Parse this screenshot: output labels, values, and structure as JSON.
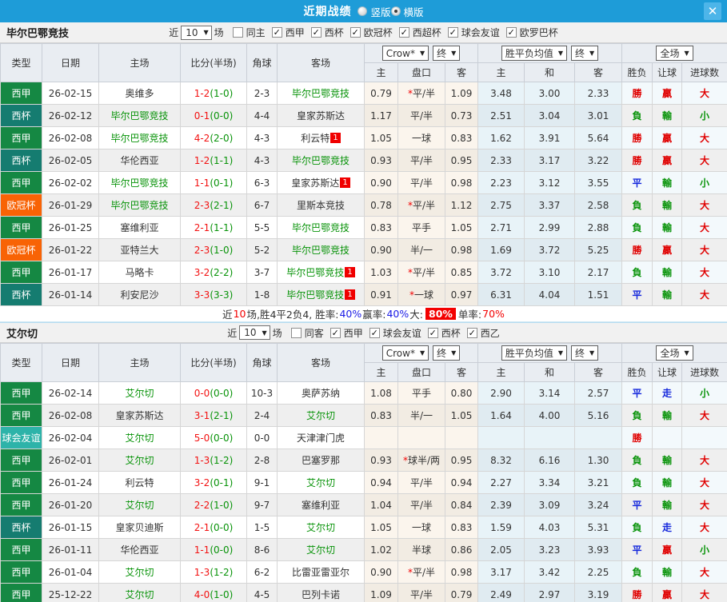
{
  "titlebar": {
    "title": "近期战绩",
    "radios": [
      {
        "label": "竖版",
        "selected": false
      },
      {
        "label": "横版",
        "selected": true
      }
    ],
    "close_label": "✕"
  },
  "icons": {
    "dropdown_arrow": "▼",
    "check": "✓"
  },
  "table_header": {
    "type": "类型",
    "date": "日期",
    "home": "主场",
    "score": "比分(半场)",
    "corner": "角球",
    "away": "客场",
    "odds_dropdown": "Crow*",
    "odds_final": "终",
    "odds_sub": [
      "主",
      "盘口",
      "客"
    ],
    "mean_dropdown": "胜平负均值",
    "mean_final": "终",
    "mean_sub": [
      "主",
      "和",
      "客"
    ],
    "result_dropdown": "全场",
    "result_sub": [
      "胜负",
      "让球",
      "进球数"
    ]
  },
  "type_colors": {
    "西甲": "#158843",
    "西杯": "#157c70",
    "欧冠杯": "#f86305",
    "球会友谊": "#2db3a9"
  },
  "sections": [
    {
      "team": "毕尔巴鄂竞技",
      "filters": {
        "near": "近",
        "count": "10",
        "games": "场",
        "same": {
          "label": "同主",
          "checked": false
        },
        "leagues": [
          {
            "label": "西甲",
            "checked": true
          },
          {
            "label": "西杯",
            "checked": true
          },
          {
            "label": "欧冠杯",
            "checked": true
          },
          {
            "label": "西超杯",
            "checked": true
          },
          {
            "label": "球会友谊",
            "checked": true
          },
          {
            "label": "欧罗巴杯",
            "checked": true
          }
        ]
      },
      "rows": [
        {
          "type": "西甲",
          "date": "26-02-15",
          "home": "奥维多",
          "home_green": false,
          "home_badge": "",
          "score_ft": "1-2",
          "score_ht": "(1-0)",
          "corner": "2-3",
          "away": "毕尔巴鄂竞技",
          "away_green": true,
          "away_badge": "",
          "odds_home": "0.79",
          "handicap_star": true,
          "handicap": "平/半",
          "odds_away": "1.09",
          "mean_home": "3.48",
          "mean_draw": "3.00",
          "mean_away": "2.33",
          "outcome": "勝",
          "outcome_color": "red",
          "handicap_result": "贏",
          "handicap_result_color": "red",
          "goals": "大",
          "goals_color": "red"
        },
        {
          "type": "西杯",
          "date": "26-02-12",
          "home": "毕尔巴鄂竞技",
          "home_green": true,
          "home_badge": "",
          "score_ft": "0-1",
          "score_ht": "(0-0)",
          "corner": "4-4",
          "away": "皇家苏斯达",
          "away_green": false,
          "away_badge": "",
          "odds_home": "1.17",
          "handicap_star": false,
          "handicap": "平/半",
          "odds_away": "0.73",
          "mean_home": "2.51",
          "mean_draw": "3.04",
          "mean_away": "3.01",
          "outcome": "負",
          "outcome_color": "green",
          "handicap_result": "輸",
          "handicap_result_color": "green",
          "goals": "小",
          "goals_color": "green"
        },
        {
          "type": "西甲",
          "date": "26-02-08",
          "home": "毕尔巴鄂竞技",
          "home_green": true,
          "home_badge": "",
          "score_ft": "4-2",
          "score_ht": "(2-0)",
          "corner": "4-3",
          "away": "利云特",
          "away_green": false,
          "away_badge": "1",
          "odds_home": "1.05",
          "handicap_star": false,
          "handicap": "一球",
          "odds_away": "0.83",
          "mean_home": "1.62",
          "mean_draw": "3.91",
          "mean_away": "5.64",
          "outcome": "勝",
          "outcome_color": "red",
          "handicap_result": "贏",
          "handicap_result_color": "red",
          "goals": "大",
          "goals_color": "red"
        },
        {
          "type": "西杯",
          "date": "26-02-05",
          "home": "华伦西亚",
          "home_green": false,
          "home_badge": "",
          "score_ft": "1-2",
          "score_ht": "(1-1)",
          "corner": "4-3",
          "away": "毕尔巴鄂竞技",
          "away_green": true,
          "away_badge": "",
          "odds_home": "0.93",
          "handicap_star": false,
          "handicap": "平/半",
          "odds_away": "0.95",
          "mean_home": "2.33",
          "mean_draw": "3.17",
          "mean_away": "3.22",
          "outcome": "勝",
          "outcome_color": "red",
          "handicap_result": "贏",
          "handicap_result_color": "red",
          "goals": "大",
          "goals_color": "red"
        },
        {
          "type": "西甲",
          "date": "26-02-02",
          "home": "毕尔巴鄂竞技",
          "home_green": true,
          "home_badge": "",
          "score_ft": "1-1",
          "score_ht": "(0-1)",
          "corner": "6-3",
          "away": "皇家苏斯达",
          "away_green": false,
          "away_badge": "1",
          "odds_home": "0.90",
          "handicap_star": false,
          "handicap": "平/半",
          "odds_away": "0.98",
          "mean_home": "2.23",
          "mean_draw": "3.12",
          "mean_away": "3.55",
          "outcome": "平",
          "outcome_color": "blue",
          "handicap_result": "輸",
          "handicap_result_color": "green",
          "goals": "小",
          "goals_color": "green"
        },
        {
          "type": "欧冠杯",
          "date": "26-01-29",
          "home": "毕尔巴鄂竞技",
          "home_green": true,
          "home_badge": "",
          "score_ft": "2-3",
          "score_ht": "(2-1)",
          "corner": "6-7",
          "away": "里斯本竞技",
          "away_green": false,
          "away_badge": "",
          "odds_home": "0.78",
          "handicap_star": true,
          "handicap": "平/半",
          "odds_away": "1.12",
          "mean_home": "2.75",
          "mean_draw": "3.37",
          "mean_away": "2.58",
          "outcome": "負",
          "outcome_color": "green",
          "handicap_result": "輸",
          "handicap_result_color": "green",
          "goals": "大",
          "goals_color": "red"
        },
        {
          "type": "西甲",
          "date": "26-01-25",
          "home": "塞维利亚",
          "home_green": false,
          "home_badge": "",
          "score_ft": "2-1",
          "score_ht": "(1-1)",
          "corner": "5-5",
          "away": "毕尔巴鄂竞技",
          "away_green": true,
          "away_badge": "",
          "odds_home": "0.83",
          "handicap_star": false,
          "handicap": "平手",
          "odds_away": "1.05",
          "mean_home": "2.71",
          "mean_draw": "2.99",
          "mean_away": "2.88",
          "outcome": "負",
          "outcome_color": "green",
          "handicap_result": "輸",
          "handicap_result_color": "green",
          "goals": "大",
          "goals_color": "red"
        },
        {
          "type": "欧冠杯",
          "date": "26-01-22",
          "home": "亚特兰大",
          "home_green": false,
          "home_badge": "",
          "score_ft": "2-3",
          "score_ht": "(1-0)",
          "corner": "5-2",
          "away": "毕尔巴鄂竞技",
          "away_green": true,
          "away_badge": "",
          "odds_home": "0.90",
          "handicap_star": false,
          "handicap": "半/一",
          "odds_away": "0.98",
          "mean_home": "1.69",
          "mean_draw": "3.72",
          "mean_away": "5.25",
          "outcome": "勝",
          "outcome_color": "red",
          "handicap_result": "贏",
          "handicap_result_color": "red",
          "goals": "大",
          "goals_color": "red"
        },
        {
          "type": "西甲",
          "date": "26-01-17",
          "home": "马略卡",
          "home_green": false,
          "home_badge": "",
          "score_ft": "3-2",
          "score_ht": "(2-2)",
          "corner": "3-7",
          "away": "毕尔巴鄂竞技",
          "away_green": true,
          "away_badge": "1",
          "odds_home": "1.03",
          "handicap_star": true,
          "handicap": "平/半",
          "odds_away": "0.85",
          "mean_home": "3.72",
          "mean_draw": "3.10",
          "mean_away": "2.17",
          "outcome": "負",
          "outcome_color": "green",
          "handicap_result": "輸",
          "handicap_result_color": "green",
          "goals": "大",
          "goals_color": "red"
        },
        {
          "type": "西杯",
          "date": "26-01-14",
          "home": "利安尼沙",
          "home_green": false,
          "home_badge": "",
          "score_ft": "3-3",
          "score_ht": "(3-3)",
          "corner": "1-8",
          "away": "毕尔巴鄂竞技",
          "away_green": true,
          "away_badge": "1",
          "odds_home": "0.91",
          "handicap_star": true,
          "handicap": "一球",
          "odds_away": "0.97",
          "mean_home": "6.31",
          "mean_draw": "4.04",
          "mean_away": "1.51",
          "outcome": "平",
          "outcome_color": "blue",
          "handicap_result": "輸",
          "handicap_result_color": "green",
          "goals": "大",
          "goals_color": "red"
        }
      ],
      "summary": [
        {
          "text": "近",
          "style": "plain"
        },
        {
          "text": "10",
          "style": "red"
        },
        {
          "text": "场,胜4平2负4, 胜率:",
          "style": "plain"
        },
        {
          "text": "40%",
          "style": "blue"
        },
        {
          "text": " 赢率:",
          "style": "plain"
        },
        {
          "text": "40%",
          "style": "blue"
        },
        {
          "text": " 大:",
          "style": "plain"
        },
        {
          "text": "80%",
          "style": "highlight"
        },
        {
          "text": " 单率:",
          "style": "plain"
        },
        {
          "text": "70%",
          "style": "red"
        }
      ]
    },
    {
      "team": "艾尔切",
      "filters": {
        "near": "近",
        "count": "10",
        "games": "场",
        "same": {
          "label": "同客",
          "checked": false
        },
        "leagues": [
          {
            "label": "西甲",
            "checked": true
          },
          {
            "label": "球会友谊",
            "checked": true
          },
          {
            "label": "西杯",
            "checked": true
          },
          {
            "label": "西乙",
            "checked": true
          }
        ]
      },
      "rows": [
        {
          "type": "西甲",
          "date": "26-02-14",
          "home": "艾尔切",
          "home_green": true,
          "home_badge": "",
          "score_ft": "0-0",
          "score_ht": "(0-0)",
          "corner": "10-3",
          "away": "奥萨苏纳",
          "away_green": false,
          "away_badge": "",
          "odds_home": "1.08",
          "handicap_star": false,
          "handicap": "平手",
          "odds_away": "0.80",
          "mean_home": "2.90",
          "mean_draw": "3.14",
          "mean_away": "2.57",
          "outcome": "平",
          "outcome_color": "blue",
          "handicap_result": "走",
          "handicap_result_color": "blue",
          "goals": "小",
          "goals_color": "green"
        },
        {
          "type": "西甲",
          "date": "26-02-08",
          "home": "皇家苏斯达",
          "home_green": false,
          "home_badge": "",
          "score_ft": "3-1",
          "score_ht": "(2-1)",
          "corner": "2-4",
          "away": "艾尔切",
          "away_green": true,
          "away_badge": "",
          "odds_home": "0.83",
          "handicap_star": false,
          "handicap": "半/一",
          "odds_away": "1.05",
          "mean_home": "1.64",
          "mean_draw": "4.00",
          "mean_away": "5.16",
          "outcome": "負",
          "outcome_color": "green",
          "handicap_result": "輸",
          "handicap_result_color": "green",
          "goals": "大",
          "goals_color": "red"
        },
        {
          "type": "球会友谊",
          "date": "26-02-04",
          "home": "艾尔切",
          "home_green": true,
          "home_badge": "",
          "score_ft": "5-0",
          "score_ht": "(0-0)",
          "corner": "0-0",
          "away": "天津津门虎",
          "away_green": false,
          "away_badge": "",
          "odds_home": "",
          "handicap_star": false,
          "handicap": "",
          "odds_away": "",
          "mean_home": "",
          "mean_draw": "",
          "mean_away": "",
          "outcome": "勝",
          "outcome_color": "red",
          "handicap_result": "",
          "handicap_result_color": "",
          "goals": "",
          "goals_color": ""
        },
        {
          "type": "西甲",
          "date": "26-02-01",
          "home": "艾尔切",
          "home_green": true,
          "home_badge": "",
          "score_ft": "1-3",
          "score_ht": "(1-2)",
          "corner": "2-8",
          "away": "巴塞罗那",
          "away_green": false,
          "away_badge": "",
          "odds_home": "0.93",
          "handicap_star": true,
          "handicap": "球半/两",
          "odds_away": "0.95",
          "mean_home": "8.32",
          "mean_draw": "6.16",
          "mean_away": "1.30",
          "outcome": "負",
          "outcome_color": "green",
          "handicap_result": "輸",
          "handicap_result_color": "green",
          "goals": "大",
          "goals_color": "red"
        },
        {
          "type": "西甲",
          "date": "26-01-24",
          "home": "利云特",
          "home_green": false,
          "home_badge": "",
          "score_ft": "3-2",
          "score_ht": "(0-1)",
          "corner": "9-1",
          "away": "艾尔切",
          "away_green": true,
          "away_badge": "",
          "odds_home": "0.94",
          "handicap_star": false,
          "handicap": "平/半",
          "odds_away": "0.94",
          "mean_home": "2.27",
          "mean_draw": "3.34",
          "mean_away": "3.21",
          "outcome": "負",
          "outcome_color": "green",
          "handicap_result": "輸",
          "handicap_result_color": "green",
          "goals": "大",
          "goals_color": "red"
        },
        {
          "type": "西甲",
          "date": "26-01-20",
          "home": "艾尔切",
          "home_green": true,
          "home_badge": "",
          "score_ft": "2-2",
          "score_ht": "(1-0)",
          "corner": "9-7",
          "away": "塞维利亚",
          "away_green": false,
          "away_badge": "",
          "odds_home": "1.04",
          "handicap_star": false,
          "handicap": "平/半",
          "odds_away": "0.84",
          "mean_home": "2.39",
          "mean_draw": "3.09",
          "mean_away": "3.24",
          "outcome": "平",
          "outcome_color": "blue",
          "handicap_result": "輸",
          "handicap_result_color": "green",
          "goals": "大",
          "goals_color": "red"
        },
        {
          "type": "西杯",
          "date": "26-01-15",
          "home": "皇家贝迪斯",
          "home_green": false,
          "home_badge": "",
          "score_ft": "2-1",
          "score_ht": "(0-0)",
          "corner": "1-5",
          "away": "艾尔切",
          "away_green": true,
          "away_badge": "",
          "odds_home": "1.05",
          "handicap_star": false,
          "handicap": "一球",
          "odds_away": "0.83",
          "mean_home": "1.59",
          "mean_draw": "4.03",
          "mean_away": "5.31",
          "outcome": "負",
          "outcome_color": "green",
          "handicap_result": "走",
          "handicap_result_color": "blue",
          "goals": "大",
          "goals_color": "red"
        },
        {
          "type": "西甲",
          "date": "26-01-11",
          "home": "华伦西亚",
          "home_green": false,
          "home_badge": "",
          "score_ft": "1-1",
          "score_ht": "(0-0)",
          "corner": "8-6",
          "away": "艾尔切",
          "away_green": true,
          "away_badge": "",
          "odds_home": "1.02",
          "handicap_star": false,
          "handicap": "半球",
          "odds_away": "0.86",
          "mean_home": "2.05",
          "mean_draw": "3.23",
          "mean_away": "3.93",
          "outcome": "平",
          "outcome_color": "blue",
          "handicap_result": "贏",
          "handicap_result_color": "red",
          "goals": "小",
          "goals_color": "green"
        },
        {
          "type": "西甲",
          "date": "26-01-04",
          "home": "艾尔切",
          "home_green": true,
          "home_badge": "",
          "score_ft": "1-3",
          "score_ht": "(1-2)",
          "corner": "6-2",
          "away": "比雷亚雷亚尔",
          "away_green": false,
          "away_badge": "",
          "odds_home": "0.90",
          "handicap_star": true,
          "handicap": "平/半",
          "odds_away": "0.98",
          "mean_home": "3.17",
          "mean_draw": "3.42",
          "mean_away": "2.25",
          "outcome": "負",
          "outcome_color": "green",
          "handicap_result": "輸",
          "handicap_result_color": "green",
          "goals": "大",
          "goals_color": "red"
        },
        {
          "type": "西甲",
          "date": "25-12-22",
          "home": "艾尔切",
          "home_green": true,
          "home_badge": "",
          "score_ft": "4-0",
          "score_ht": "(1-0)",
          "corner": "4-5",
          "away": "巴列卡诺",
          "away_green": false,
          "away_badge": "",
          "odds_home": "1.09",
          "handicap_star": false,
          "handicap": "平/半",
          "odds_away": "0.79",
          "mean_home": "2.49",
          "mean_draw": "2.97",
          "mean_away": "3.19",
          "outcome": "勝",
          "outcome_color": "red",
          "handicap_result": "贏",
          "handicap_result_color": "red",
          "goals": "大",
          "goals_color": "red"
        }
      ],
      "summary": null
    }
  ]
}
